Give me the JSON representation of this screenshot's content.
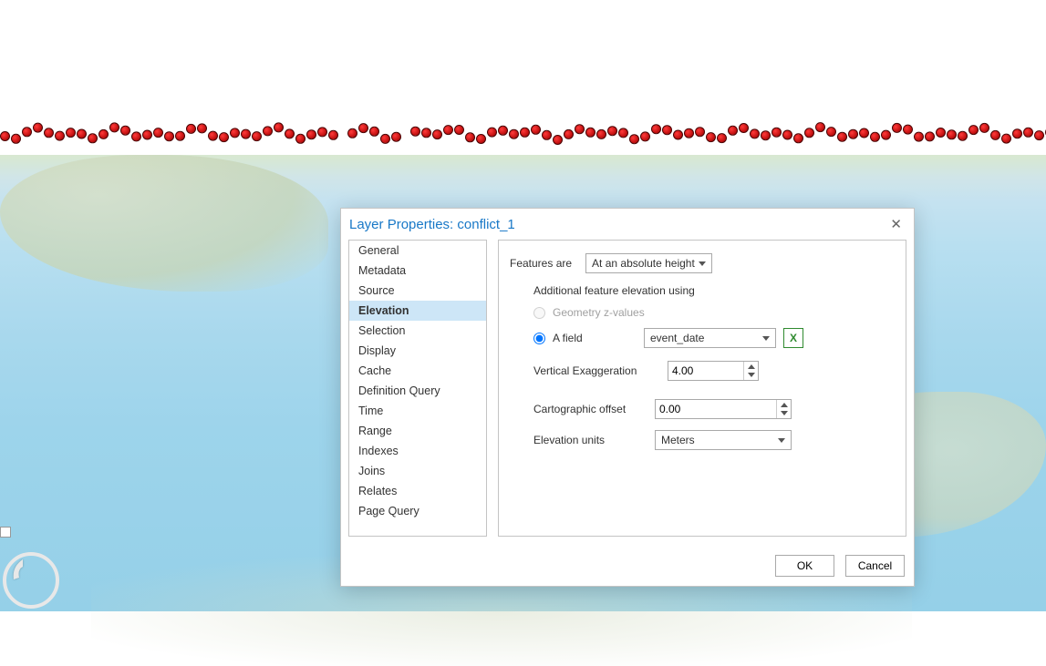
{
  "dialog": {
    "title": "Layer Properties: conflict_1",
    "sideItems": [
      "General",
      "Metadata",
      "Source",
      "Elevation",
      "Selection",
      "Display",
      "Cache",
      "Definition Query",
      "Time",
      "Range",
      "Indexes",
      "Joins",
      "Relates",
      "Page Query"
    ],
    "selectedSide": "Elevation",
    "featuresAreLabel": "Features are",
    "featuresAreValue": "At an absolute height",
    "additionalHeader": "Additional feature elevation using",
    "radioGeometry": "Geometry z-values",
    "radioField": "A field",
    "fieldValue": "event_date",
    "vertExagLabel": "Vertical Exaggeration",
    "vertExagValue": "4.00",
    "cartoOffsetLabel": "Cartographic offset",
    "cartoOffsetValue": "0.00",
    "elevUnitsLabel": "Elevation units",
    "elevUnitsValue": "Meters",
    "ok": "OK",
    "cancel": "Cancel"
  }
}
